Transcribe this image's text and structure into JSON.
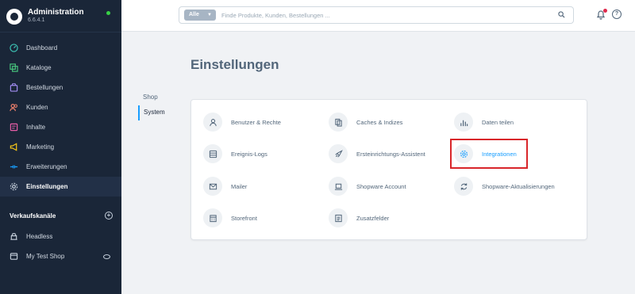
{
  "app": {
    "name": "Administration",
    "version": "6.6.4.1",
    "status_color": "#37d046"
  },
  "sidebar": {
    "items": [
      {
        "label": "Dashboard",
        "icon": "dashboard-icon",
        "color": "#3ec7b8"
      },
      {
        "label": "Kataloge",
        "icon": "catalog-icon",
        "color": "#47c47d"
      },
      {
        "label": "Bestellungen",
        "icon": "orders-icon",
        "color": "#a08cf0"
      },
      {
        "label": "Kunden",
        "icon": "customers-icon",
        "color": "#f0806c"
      },
      {
        "label": "Inhalte",
        "icon": "content-icon",
        "color": "#e85ea8"
      },
      {
        "label": "Marketing",
        "icon": "marketing-icon",
        "color": "#f5c518"
      },
      {
        "label": "Erweiterungen",
        "icon": "extensions-icon",
        "color": "#189eff"
      },
      {
        "label": "Einstellungen",
        "icon": "settings-icon",
        "color": "#c7d1dd",
        "active": true
      }
    ],
    "sales_channels_title": "Verkaufskanäle",
    "sales_channels": [
      {
        "label": "Headless",
        "icon": "headless-icon"
      },
      {
        "label": "My Test Shop",
        "icon": "shop-icon"
      }
    ]
  },
  "topbar": {
    "search_scope": "Alle",
    "search_placeholder": "Finde Produkte, Kunden, Bestellungen ..."
  },
  "main": {
    "title": "Einstellungen",
    "tabs": [
      {
        "label": "Shop",
        "active": false
      },
      {
        "label": "System",
        "active": true
      }
    ],
    "settings": [
      {
        "label": "Benutzer & Rechte",
        "icon": "user-icon"
      },
      {
        "label": "Caches & Indizes",
        "icon": "copy-icon"
      },
      {
        "label": "Daten teilen",
        "icon": "chart-icon"
      },
      {
        "label": "Ereignis-Logs",
        "icon": "log-icon"
      },
      {
        "label": "Ersteinrichtungs-Assistent",
        "icon": "rocket-icon"
      },
      {
        "label": "Integrationen",
        "icon": "gear-icon",
        "highlighted": true
      },
      {
        "label": "Mailer",
        "icon": "envelope-icon"
      },
      {
        "label": "Shopware Account",
        "icon": "laptop-icon"
      },
      {
        "label": "Shopware-Aktualisierungen",
        "icon": "refresh-icon"
      },
      {
        "label": "Storefront",
        "icon": "storefront-icon"
      },
      {
        "label": "Zusatzfelder",
        "icon": "fields-icon"
      }
    ]
  },
  "colors": {
    "sidebar_bg": "#1a2638",
    "accent": "#189eff",
    "highlight_box": "#d9262a"
  }
}
